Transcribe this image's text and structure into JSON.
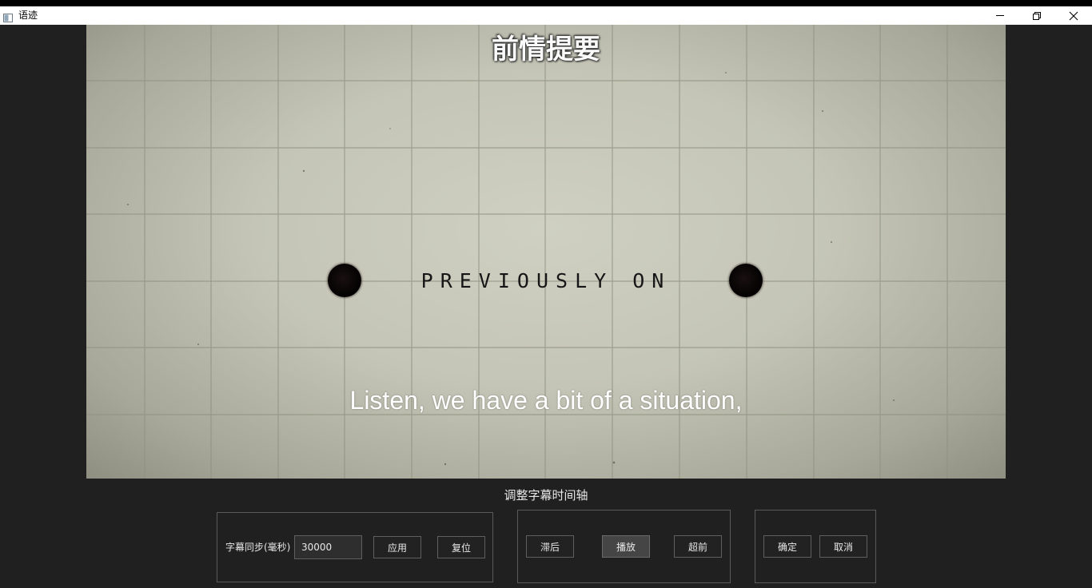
{
  "window": {
    "title": "语迹",
    "icon": "app-window-icon",
    "controls": {
      "minimize": "minimize-icon",
      "maximize": "restore-icon",
      "close": "close-icon"
    }
  },
  "video": {
    "subtitle_top": "前情提要",
    "on_screen_text": "PREVIOUSLY ON",
    "subtitle_bottom": "Listen, we have a bit of a situation,"
  },
  "timeline_panel": {
    "title": "调整字幕时间轴",
    "sync": {
      "label": "字幕同步(毫秒)",
      "value": "30000",
      "apply_label": "应用",
      "reset_label": "复位"
    },
    "playback": {
      "delay_label": "滞后",
      "play_label": "播放",
      "advance_label": "超前"
    },
    "confirm": {
      "ok_label": "确定",
      "cancel_label": "取消"
    }
  },
  "colors": {
    "background": "#202020",
    "titlebar": "#ffffff",
    "text": "#e8e8e8",
    "border": "#5f5f5f"
  }
}
